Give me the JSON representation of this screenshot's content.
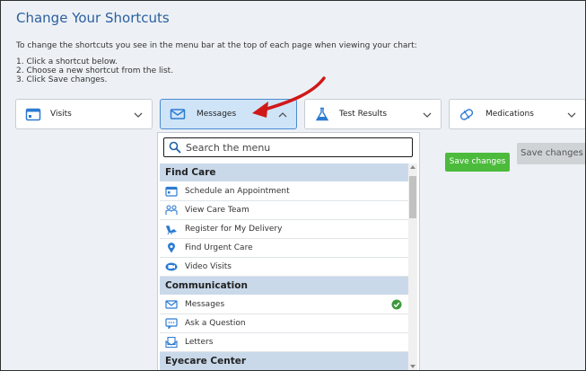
{
  "page": {
    "title": "Change Your Shortcuts",
    "intro": "To change the shortcuts you see in the menu bar at the top of each page when viewing your chart:",
    "steps": [
      "1. Click a shortcut below.",
      "2. Choose a new shortcut from the list.",
      "3. Click Save changes."
    ]
  },
  "shortcuts": [
    {
      "label": "Visits",
      "icon": "calendar-icon"
    },
    {
      "label": "Messages",
      "icon": "envelope-icon"
    },
    {
      "label": "Test Results",
      "icon": "flask-icon"
    },
    {
      "label": "Medications",
      "icon": "pill-icon"
    }
  ],
  "buttons": {
    "save_green": "Save changes",
    "save_grey": "Save changes"
  },
  "dropdown": {
    "search_placeholder": "Search the menu",
    "sections": [
      {
        "header": "Find Care",
        "items": [
          {
            "label": "Schedule an Appointment",
            "icon": "calendar-icon"
          },
          {
            "label": "View Care Team",
            "icon": "people-icon"
          },
          {
            "label": "Register for My Delivery",
            "icon": "stork-icon"
          },
          {
            "label": "Find Urgent Care",
            "icon": "location-pin-icon"
          },
          {
            "label": "Video Visits",
            "icon": "video-camera-icon"
          }
        ]
      },
      {
        "header": "Communication",
        "items": [
          {
            "label": "Messages",
            "icon": "envelope-icon",
            "selected": true
          },
          {
            "label": "Ask a Question",
            "icon": "chat-bubble-icon"
          },
          {
            "label": "Letters",
            "icon": "letter-icon"
          }
        ]
      },
      {
        "header": "Eyecare Center",
        "items": []
      }
    ]
  },
  "colors": {
    "title": "#2a5f9e",
    "accent_red_arrow": "#d01818",
    "save_green": "#4cbb3c",
    "header_bg": "#c9d9ea",
    "icon_blue": "#2c7bd2"
  }
}
